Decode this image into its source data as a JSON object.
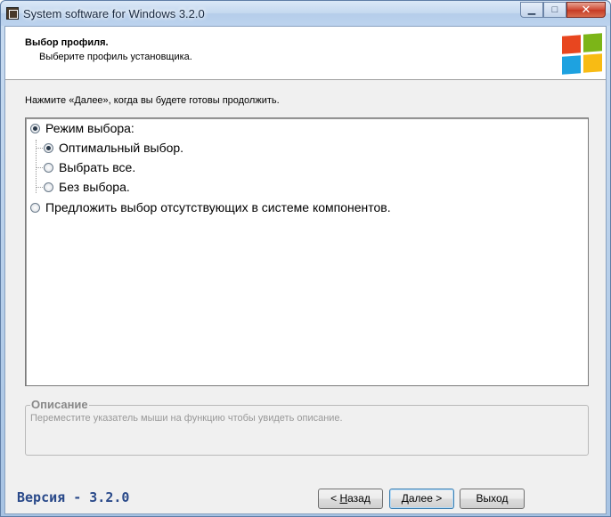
{
  "window": {
    "title": "System software for Windows 3.2.0"
  },
  "titlebar": {
    "min_glyph": "▁",
    "max_glyph": "□",
    "close_glyph": "✕"
  },
  "header": {
    "title": "Выбор профиля.",
    "subtitle": "Выберите профиль установщика.",
    "logo_colors": [
      "#e8461f",
      "#7cb518",
      "#1ea2e0",
      "#f8bb14"
    ]
  },
  "prompt": "Нажмите «Далее», когда вы будете готовы продолжить.",
  "options": {
    "root": {
      "label": "Режим выбора:",
      "selected": true
    },
    "children": [
      {
        "label": "Оптимальный выбор.",
        "selected": true
      },
      {
        "label": "Выбрать все.",
        "selected": false
      },
      {
        "label": "Без выбора.",
        "selected": false
      }
    ],
    "other": {
      "label": "Предложить выбор отсутствующих в системе компонентов.",
      "selected": false
    }
  },
  "description": {
    "legend": "Описание",
    "text": "Переместите указатель мыши на функцию чтобы увидеть описание."
  },
  "footer": {
    "version": "Версия - 3.2.0",
    "back_prefix": "< ",
    "back_hotkey": "Н",
    "back_rest": "азад",
    "next_label": "Далее >",
    "exit_label": "Выход"
  }
}
